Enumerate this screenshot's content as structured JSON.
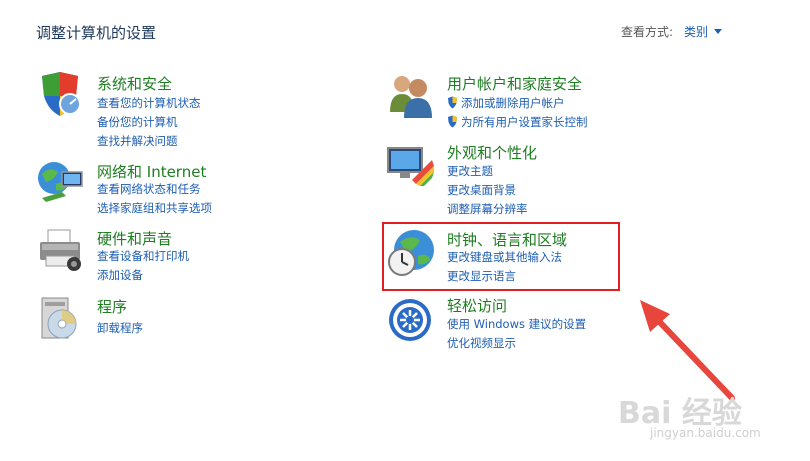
{
  "header": {
    "title": "调整计算机的设置",
    "view_by_label": "查看方式:",
    "view_by_value": "类别"
  },
  "categories": [
    {
      "title": "系统和安全",
      "icon": "shield-icon",
      "links": [
        "查看您的计算机状态",
        "备份您的计算机",
        "查找并解决问题"
      ]
    },
    {
      "title": "网络和 Internet",
      "icon": "network-globe-icon",
      "links": [
        "查看网络状态和任务",
        "选择家庭组和共享选项"
      ]
    },
    {
      "title": "硬件和声音",
      "icon": "printer-icon",
      "links": [
        "查看设备和打印机",
        "添加设备"
      ]
    },
    {
      "title": "程序",
      "icon": "programs-icon",
      "links": [
        "卸载程序"
      ]
    },
    {
      "title": "用户帐户和家庭安全",
      "icon": "users-icon",
      "links": [
        "添加或删除用户帐户",
        "为所有用户设置家长控制"
      ]
    },
    {
      "title": "外观和个性化",
      "icon": "monitor-palette-icon",
      "links": [
        "更改主题",
        "更改桌面背景",
        "调整屏幕分辨率"
      ]
    },
    {
      "title": "时钟、语言和区域",
      "icon": "globe-clock-icon",
      "links": [
        "更改键盘或其他输入法",
        "更改显示语言"
      ]
    },
    {
      "title": "轻松访问",
      "icon": "ease-of-access-icon",
      "links": [
        "使用 Windows 建议的设置",
        "优化视频显示"
      ]
    }
  ],
  "watermark": {
    "text": "Bai 经验",
    "subtext": "jingyan.baidu.com"
  },
  "colors": {
    "category_title": "#1e7d21",
    "link": "#1e5eb3",
    "highlight": "#e02020"
  }
}
